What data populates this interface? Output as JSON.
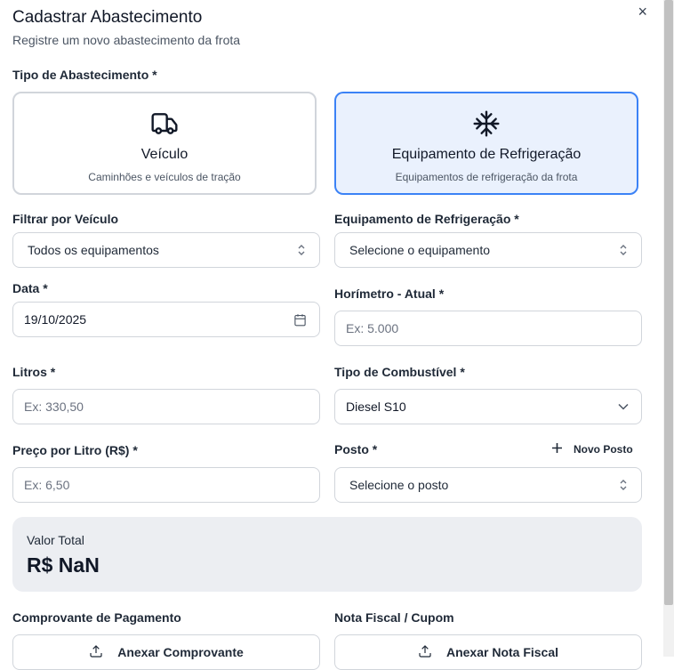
{
  "dialog": {
    "title": "Cadastrar Abastecimento",
    "subtitle": "Registre um novo abastecimento da frota",
    "close_glyph": "×"
  },
  "type_section": {
    "label": "Tipo de Abastecimento *",
    "options": [
      {
        "title": "Veículo",
        "description": "Caminhões e veículos de tração",
        "icon": "truck-icon",
        "selected": false
      },
      {
        "title": "Equipamento de Refrigeração",
        "description": "Equipamentos de refrigeração da frota",
        "icon": "snowflake-icon",
        "selected": true
      }
    ]
  },
  "filter_vehicle": {
    "label": "Filtrar por Veículo",
    "value": "Todos os equipamentos"
  },
  "equipment": {
    "label": "Equipamento de Refrigeração *",
    "value": "Selecione o equipamento"
  },
  "date": {
    "label": "Data *",
    "value": "19/10/2025"
  },
  "hourmeter": {
    "label": "Horímetro - Atual *",
    "placeholder": "Ex: 5.000"
  },
  "liters": {
    "label": "Litros *",
    "placeholder": "Ex: 330,50"
  },
  "fuel_type": {
    "label": "Tipo de Combustível *",
    "value": "Diesel S10"
  },
  "price": {
    "label": "Preço por Litro (R$) *",
    "placeholder": "Ex: 6,50"
  },
  "station": {
    "label": "Posto *",
    "value": "Selecione o posto",
    "new_label": "Novo Posto"
  },
  "total": {
    "label": "Valor Total",
    "value": "R$ NaN"
  },
  "payment_receipt": {
    "label": "Comprovante de Pagamento",
    "button": "Anexar Comprovante"
  },
  "invoice": {
    "label": "Nota Fiscal / Cupom",
    "button": "Anexar Nota Fiscal"
  },
  "colors": {
    "accent": "#3b82f6",
    "accent_bg": "#eaf1fd",
    "border": "#d1d5db",
    "total_bg": "#eceef2"
  }
}
